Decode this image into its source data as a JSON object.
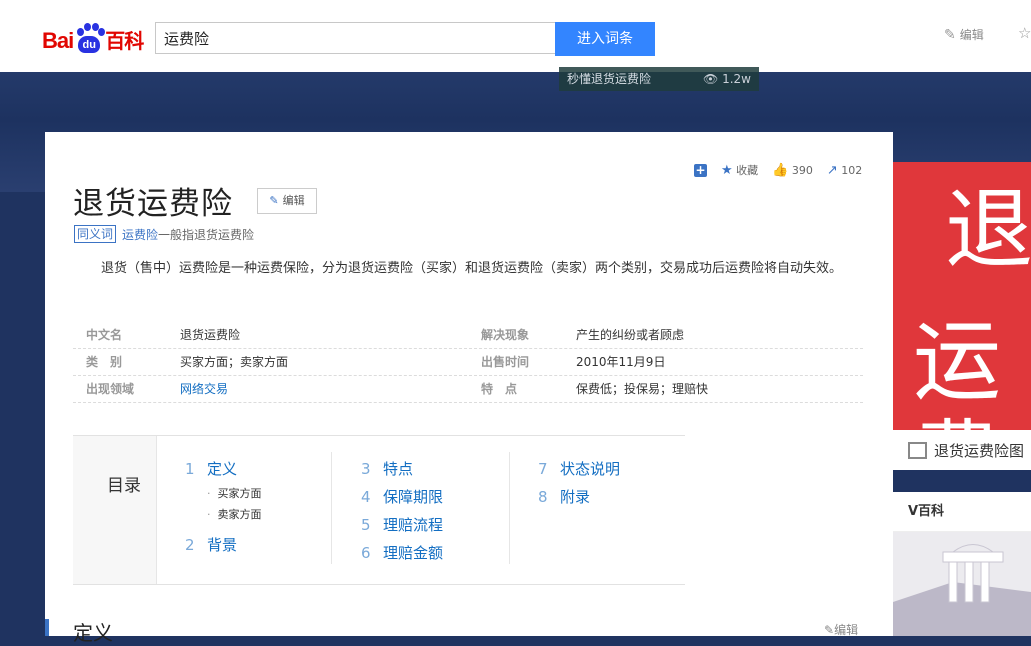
{
  "header": {
    "logo": {
      "bai": "Bai",
      "du": "du",
      "baike": "百科"
    },
    "search": {
      "value": "运费险"
    },
    "search_button": "进入词条",
    "edit_label": "编辑"
  },
  "banner": {
    "video_title": "秒懂退货运费险",
    "video_views": "1.2w"
  },
  "actions": {
    "favorite": "收藏",
    "likes": "390",
    "shares": "102"
  },
  "entry": {
    "title": "退货运费险",
    "edit_label": "编辑",
    "synonym_tag": "同义词",
    "synonym_link": "运费险",
    "synonym_text": "一般指退货运费险",
    "summary": "退货（售中）运费险是一种运费保险，分为退货运费险（买家）和退货运费险（卖家）两个类别，交易成功后运费险将自动失效。"
  },
  "info": [
    {
      "k1": "中文名",
      "v1": "退货运费险",
      "k2": "解决现象",
      "v2": "产生的纠纷或者顾虑"
    },
    {
      "k1": "类　别",
      "v1": "买家方面；卖家方面",
      "k2": "出售时间",
      "v2": "2010年11月9日"
    },
    {
      "k1": "出现领域",
      "v1": "网络交易",
      "k2": "特　点",
      "v2": "保费低；投保易；理赔快"
    }
  ],
  "catalog": {
    "title": "目录",
    "col1": [
      {
        "n": "1",
        "label": "定义"
      },
      {
        "sub": "买家方面"
      },
      {
        "sub": "卖家方面"
      },
      {
        "n": "2",
        "label": "背景"
      }
    ],
    "col2": [
      {
        "n": "3",
        "label": "特点"
      },
      {
        "n": "4",
        "label": "保障期限"
      },
      {
        "n": "5",
        "label": "理赔流程"
      },
      {
        "n": "6",
        "label": "理赔金额"
      }
    ],
    "col3": [
      {
        "n": "7",
        "label": "状态说明"
      },
      {
        "n": "8",
        "label": "附录"
      }
    ]
  },
  "section": {
    "title": "定义",
    "edit_label": "编辑"
  },
  "sidebar": {
    "image_text_1": "退",
    "image_text_2": "运费",
    "caption": "退货运费险图",
    "vbaike": "V百科"
  },
  "colors": {
    "brand_red": "#e10601",
    "brand_blue": "#2932e1",
    "accent": "#3385ff",
    "link": "#136ec2"
  }
}
